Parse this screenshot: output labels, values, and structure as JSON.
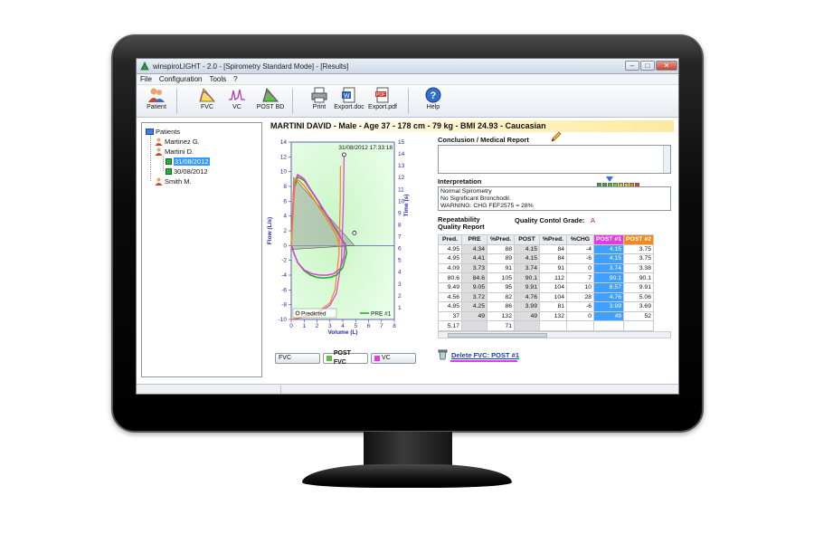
{
  "window": {
    "title": "winspiroLIGHT - 2.0 - [Spirometry Standard Mode] - [Results]",
    "min_glyph": "–",
    "max_glyph": "□",
    "close_glyph": "✕"
  },
  "menu": [
    "File",
    "Configuration",
    "Tools",
    "?"
  ],
  "toolbar": {
    "patient": "Patient",
    "fvc": "FVC",
    "vc": "VC",
    "post_bd": "POST BD",
    "print": "Print",
    "export_doc": "Export.doc",
    "export_pdf": "Export.pdf",
    "help": "Help"
  },
  "tree": {
    "root": "Patients",
    "patients": [
      "Martinez G.",
      "Martini D.",
      "Smith M."
    ],
    "dates": [
      "31/08/2012",
      "30/08/2012"
    ]
  },
  "patient_header": "MARTINI DAVID - Male - Age 37 - 178 cm - 79 kg - BMI 24.93 - Caucasian",
  "chart_data": {
    "type": "line",
    "timestamp": "31/08/2012 17:33:18",
    "xlabel": "Volume (L)",
    "ylabel": "Flow (L/s)",
    "y2label": "Time (s)",
    "xlim": [
      0,
      8
    ],
    "ylim": [
      -10,
      14
    ],
    "y2lim": [
      0,
      15
    ],
    "x_ticks": [
      0,
      1,
      2,
      3,
      4,
      5,
      6,
      7,
      8
    ],
    "y_ticks": [
      14,
      12,
      10,
      8,
      6,
      4,
      2,
      0,
      -2,
      -4,
      -6,
      -8,
      -10
    ],
    "y2_ticks": [
      1,
      2,
      3,
      4,
      5,
      6,
      7,
      8,
      9,
      10,
      11,
      12,
      13,
      14,
      15
    ],
    "legend": [
      "Predicted",
      "PRE #1"
    ],
    "series": [
      {
        "name": "PRE #1",
        "color": "#22aa22",
        "x": [
          0,
          0.2,
          0.5,
          1.0,
          1.5,
          2.0,
          2.5,
          3.0,
          3.5,
          3.9,
          4.2,
          4.3,
          4.0,
          3.5,
          3.0,
          2.5,
          2.0,
          1.5,
          1.0,
          0.5,
          0.2,
          0
        ],
        "y": [
          0,
          7.5,
          9.3,
          8.8,
          7.5,
          6.2,
          4.8,
          3.4,
          2.0,
          0.9,
          0.2,
          -1.0,
          -3.0,
          -4.0,
          -4.3,
          -4.4,
          -4.3,
          -4.0,
          -3.4,
          -2.3,
          -1.0,
          0
        ]
      },
      {
        "name": "",
        "color": "#e13ce1",
        "x": [
          0,
          0.2,
          0.5,
          1.0,
          1.5,
          2.0,
          2.5,
          3.0,
          3.5,
          3.9,
          4.15,
          4.1,
          3.8,
          3.3,
          2.8,
          2.2,
          1.6,
          1.0,
          0.5,
          0.2,
          0
        ],
        "y": [
          0,
          8.2,
          9.6,
          9.0,
          7.6,
          6.3,
          4.9,
          3.5,
          2.2,
          0.9,
          0.1,
          -1.5,
          -3.1,
          -3.8,
          -4.0,
          -4.0,
          -3.8,
          -3.3,
          -2.3,
          -1.0,
          0
        ]
      },
      {
        "name": "",
        "color": "#f08a1c",
        "x": [
          0,
          0.3,
          0.6,
          1.0,
          1.5,
          2.0,
          2.5,
          3.0,
          3.5,
          3.75
        ],
        "y": [
          0,
          9.0,
          8.8,
          8.1,
          6.9,
          5.6,
          4.3,
          2.9,
          1.4,
          0
        ]
      }
    ],
    "time_curves": [
      {
        "color": "#e13ce1",
        "x": [
          0,
          1,
          2,
          3,
          3.5,
          3.9,
          4.05,
          4.1
        ],
        "t": [
          0,
          0.2,
          0.5,
          1.2,
          2.2,
          5.0,
          10.0,
          13.8
        ]
      },
      {
        "color": "#f08a1c",
        "x": [
          0,
          1,
          2,
          3,
          3.4,
          3.7,
          3.8,
          3.82
        ],
        "t": [
          0,
          0.25,
          0.6,
          1.4,
          2.5,
          5.5,
          10.0,
          13.0
        ]
      }
    ]
  },
  "chart_tabs": [
    "FVC",
    "POST FVC",
    "VC"
  ],
  "conclusion": {
    "title": "Conclusion / Medical Report"
  },
  "interpretation": {
    "title": "Interpretation",
    "lines": [
      "Normal Spirometry",
      "No Significant Bronchodil.",
      "WARNING: CHG FEF2575 = 28%"
    ]
  },
  "repeatability": {
    "label": "Repeatability Quality Report",
    "quality_label": "Quality Contol Grade:",
    "grade": "A"
  },
  "results_table": {
    "headers": [
      "Pred.",
      "PRE",
      "%Pred.",
      "POST",
      "%Pred.",
      "%CHG",
      "POST #1",
      "POST #2"
    ],
    "rows": [
      [
        "4.95",
        "4.34",
        "88",
        "4.15",
        "84",
        "-4",
        "4.15",
        "3.75"
      ],
      [
        "4.95",
        "4.41",
        "89",
        "4.15",
        "84",
        "-6",
        "4.15",
        "3.75"
      ],
      [
        "4.09",
        "3.73",
        "91",
        "3.74",
        "91",
        "0",
        "3.74",
        "3.38"
      ],
      [
        "80.6",
        "84.6",
        "105",
        "90.1",
        "112",
        "7",
        "90.1",
        "90.1"
      ],
      [
        "9.49",
        "9.05",
        "95",
        "9.91",
        "104",
        "10",
        "8.57",
        "9.91"
      ],
      [
        "4.56",
        "3.72",
        "82",
        "4.76",
        "104",
        "28",
        "4.76",
        "5.06"
      ],
      [
        "4.95",
        "4.25",
        "86",
        "3.99",
        "81",
        "-6",
        "3.99",
        "3.69"
      ],
      [
        "37",
        "49",
        "132",
        "49",
        "132",
        "0",
        "49",
        "52"
      ],
      [
        "5.17",
        "",
        "71",
        "",
        "",
        "",
        "",
        ""
      ]
    ]
  },
  "delete_link": "Delete FVC: POST #1",
  "colors": {
    "pre": "#22aa22",
    "post1": "#e13ce1",
    "post2": "#f08a1c",
    "selected": "#3fa0ff"
  },
  "grade_colors": [
    "#33aa33",
    "#33aa33",
    "#55bb33",
    "#77cc33",
    "#ddcc22",
    "#eebb22",
    "#ee8822",
    "#dd4422"
  ]
}
